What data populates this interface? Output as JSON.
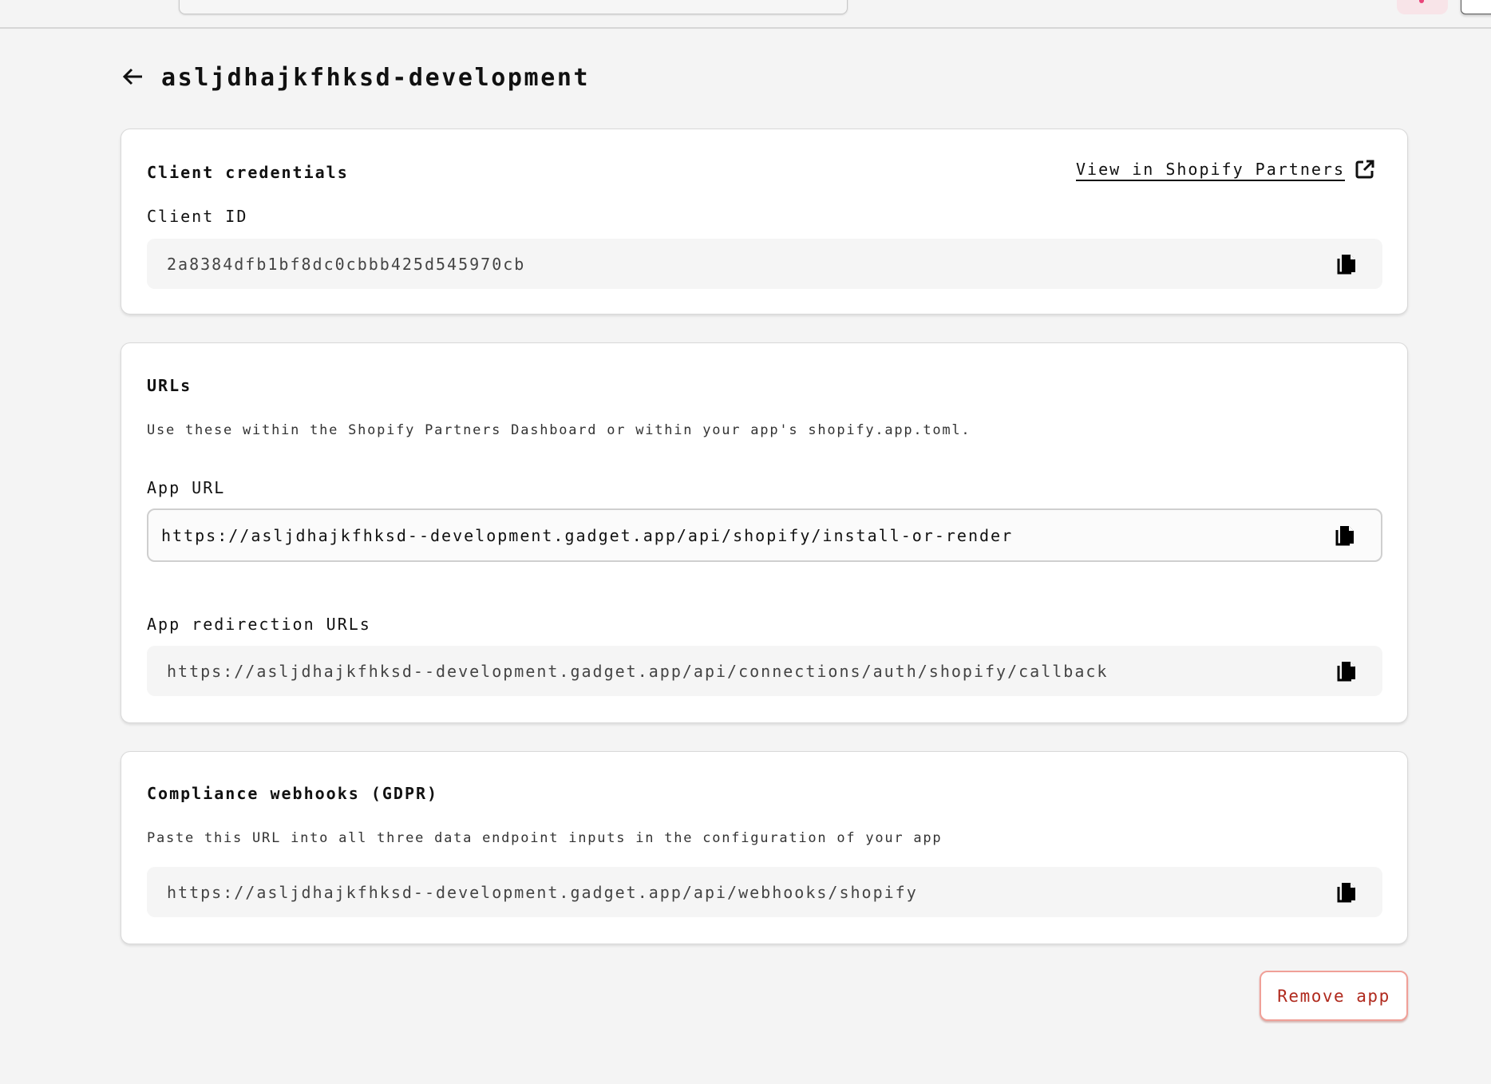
{
  "page": {
    "title": "asljdhajkfhksd-development"
  },
  "client_credentials": {
    "heading": "Client credentials",
    "partners_link": "View in Shopify Partners",
    "client_id_label": "Client ID",
    "client_id": "2a8384dfb1bf8dc0cbbb425d545970cb"
  },
  "urls": {
    "heading": "URLs",
    "description": "Use these within the Shopify Partners Dashboard or within your app's shopify.app.toml.",
    "app_url_label": "App URL",
    "app_url": "https://asljdhajkfhksd--development.gadget.app/api/shopify/install-or-render",
    "redirect_label": "App redirection URLs",
    "redirect_url": "https://asljdhajkfhksd--development.gadget.app/api/connections/auth/shopify/callback"
  },
  "compliance": {
    "heading": "Compliance webhooks (GDPR)",
    "description": "Paste this URL into all three data endpoint inputs in the configuration of your app",
    "webhook_url": "https://asljdhajkfhksd--development.gadget.app/api/webhooks/shopify"
  },
  "actions": {
    "remove_label": "Remove app"
  }
}
